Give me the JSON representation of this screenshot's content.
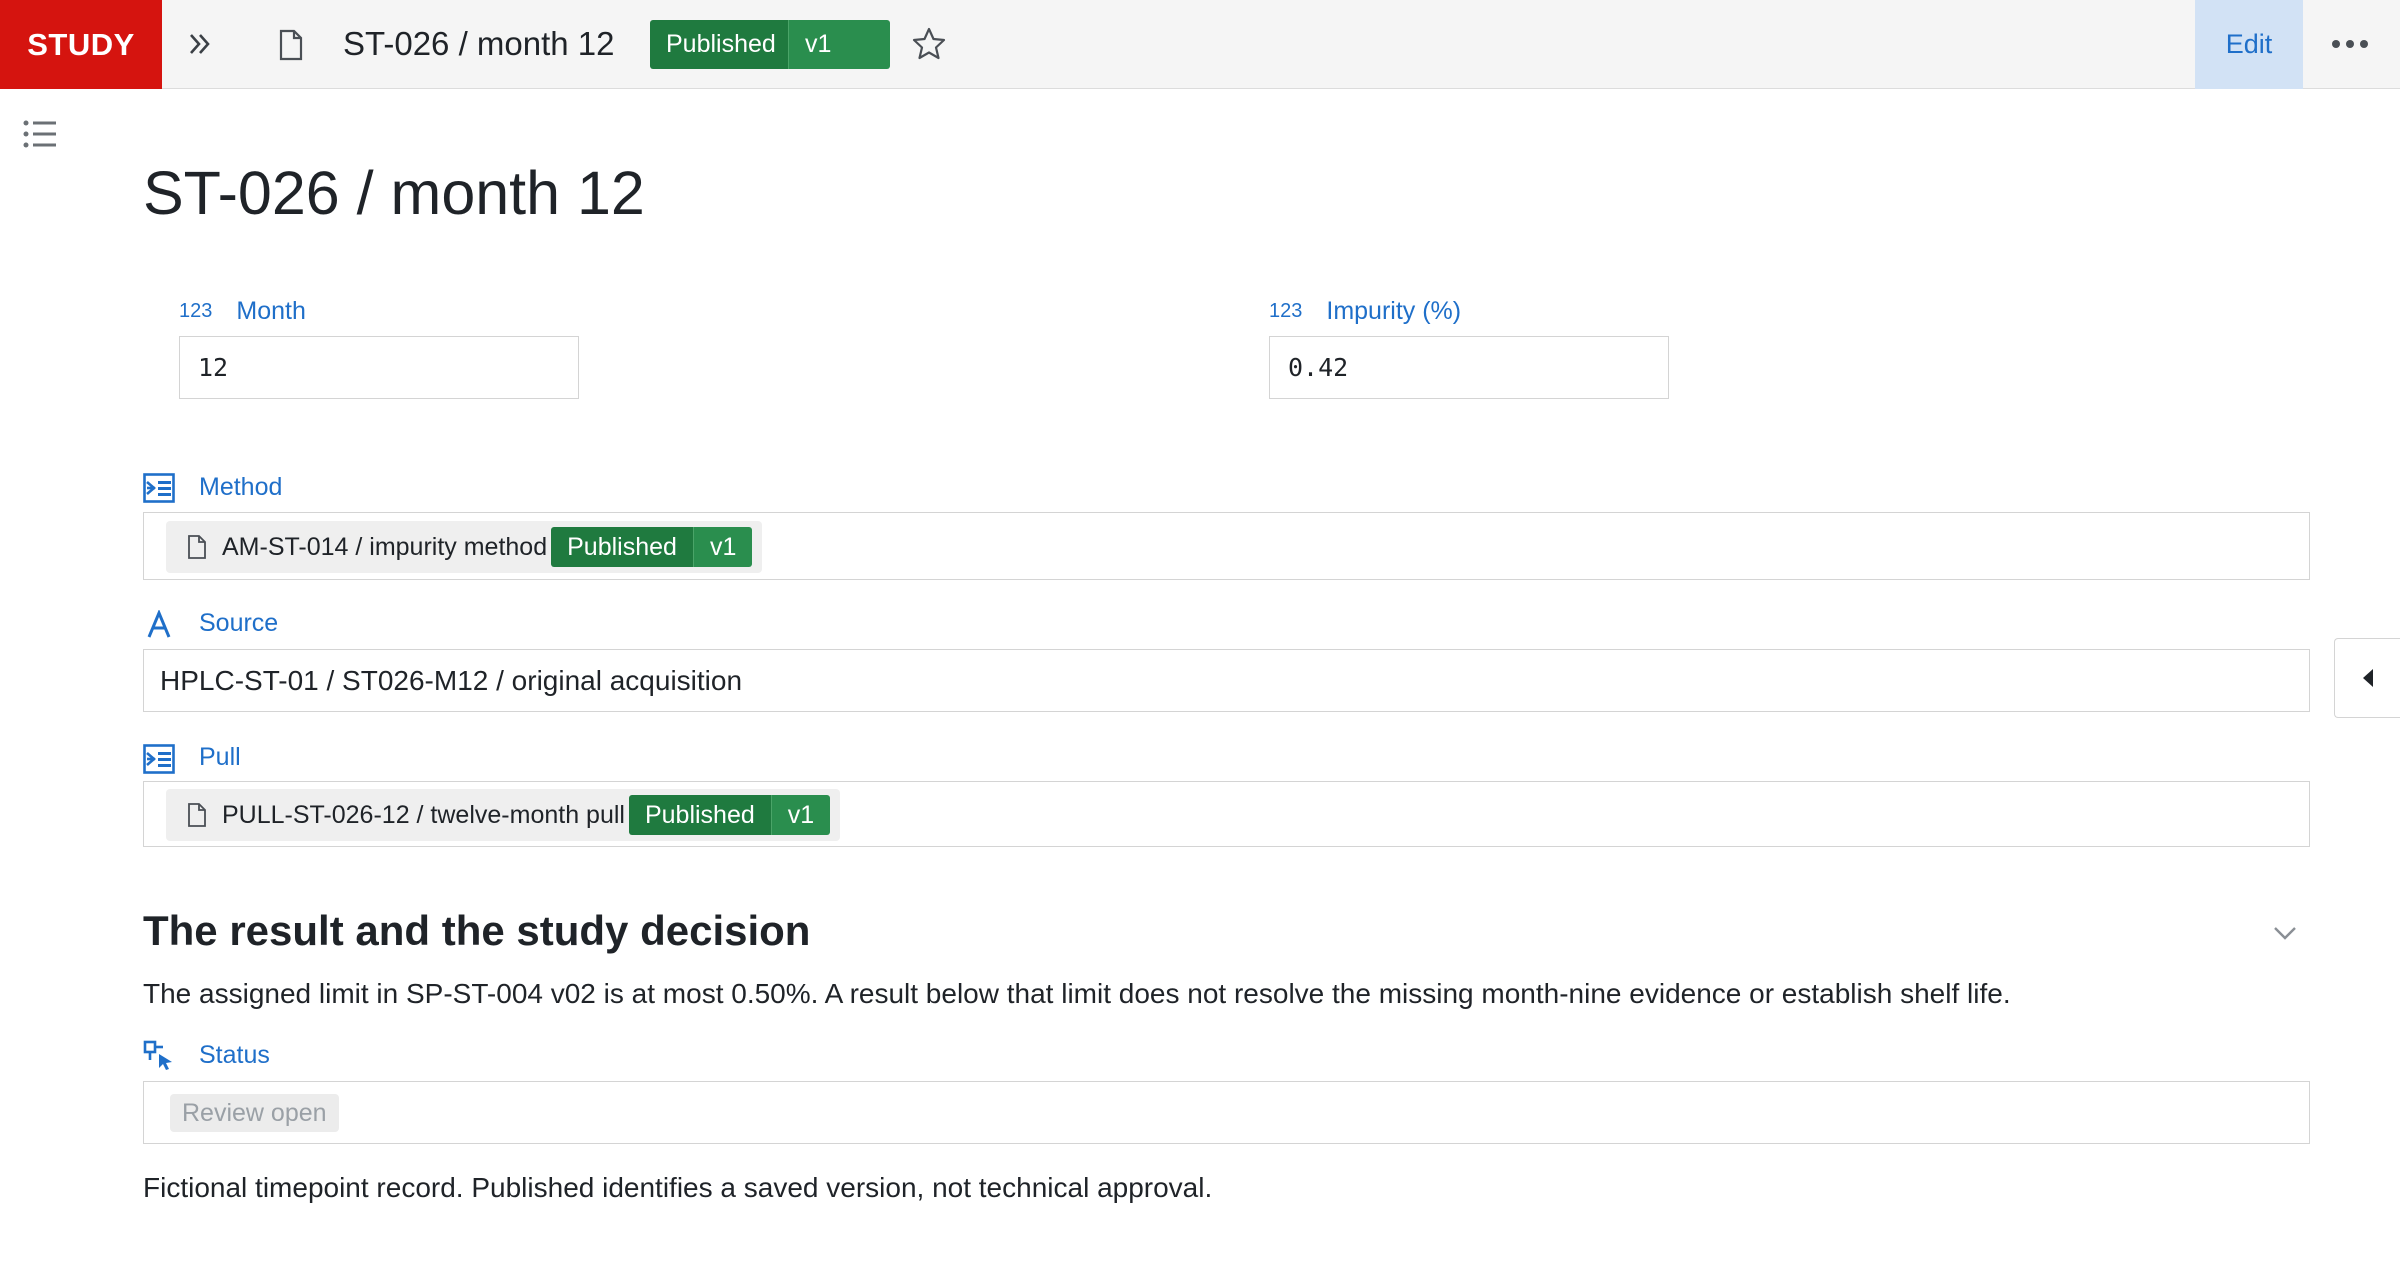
{
  "topbar": {
    "brand": "STUDY",
    "title": "ST-026 / month 12",
    "badge_status": "Published",
    "badge_version": "v1",
    "edit_label": "Edit"
  },
  "page": {
    "title": "ST-026 / month 12"
  },
  "fields": {
    "month": {
      "type_tag": "123",
      "label": "Month",
      "value": "12"
    },
    "impurity": {
      "type_tag": "123",
      "label": "Impurity (%)",
      "value": "0.42"
    },
    "method": {
      "label": "Method",
      "ref_text": "AM-ST-014 / impurity method",
      "ref_status": "Published",
      "ref_version": "v1"
    },
    "source": {
      "label": "Source",
      "value": "HPLC-ST-01 / ST026-M12 / original acquisition"
    },
    "pull": {
      "label": "Pull",
      "ref_text": "PULL-ST-026-12 / twelve-month pull",
      "ref_status": "Published",
      "ref_version": "v1"
    }
  },
  "section": {
    "heading": "The result and the study decision",
    "paragraph": "The assigned limit in SP-ST-004 v02 is at most 0.50%. A result below that limit does not resolve the missing month-nine evidence or establish shelf life.",
    "status_label": "Status",
    "status_value": "Review open",
    "footnote": "Fictional timepoint record. Published identifies a saved version, not technical approval."
  },
  "colors": {
    "brand": "#d5140f",
    "accent": "#1f6fc9",
    "published_green": "#1f7a3f",
    "version_green": "#2a8e4e",
    "edit_bg": "#d2e2f5"
  },
  "icons": [
    "double-chevron-right-icon",
    "document-icon",
    "star-icon",
    "more-dots-icon",
    "list-icon",
    "reference-field-icon",
    "text-field-icon",
    "status-field-icon",
    "chevron-down-icon",
    "caret-left-icon"
  ]
}
